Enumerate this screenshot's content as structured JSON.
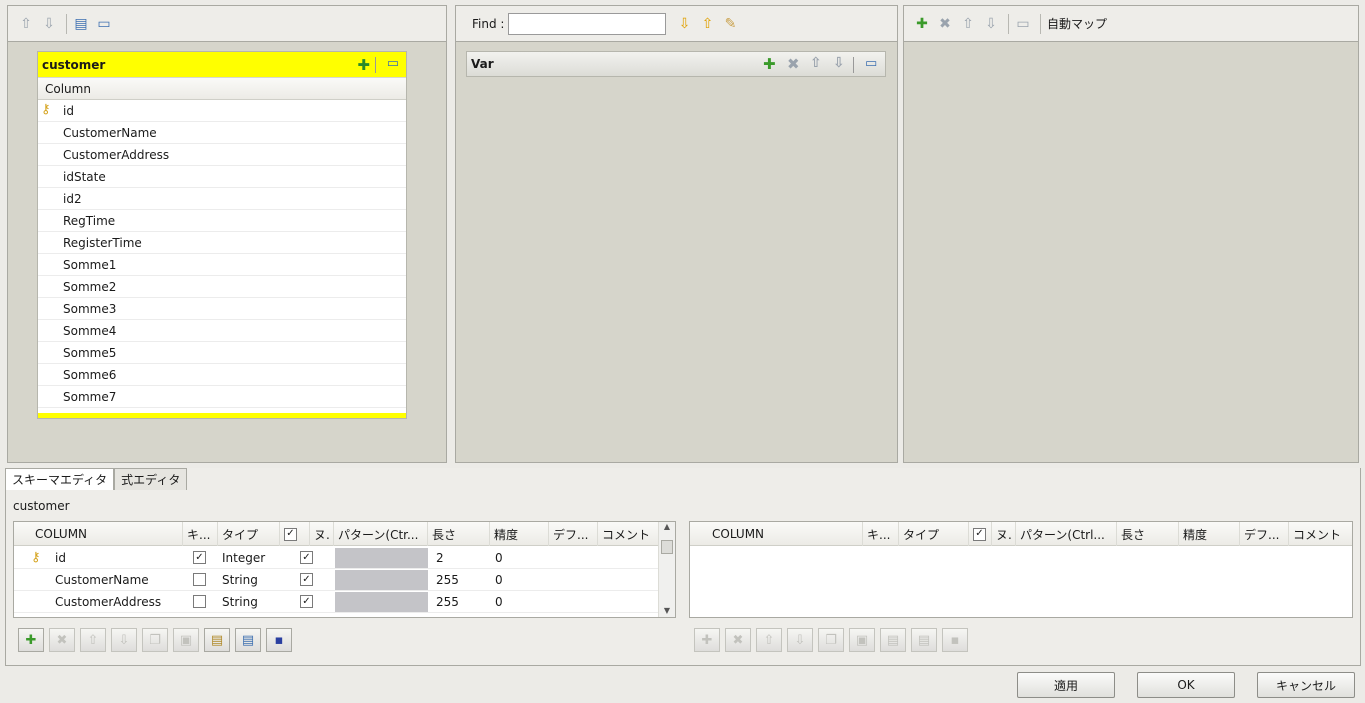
{
  "left_panel": {
    "table": {
      "name": "customer",
      "column_header": "Column",
      "rows": [
        "id",
        "CustomerName",
        "CustomerAddress",
        "idState",
        "id2",
        "RegTime",
        "RegisterTime",
        "Somme1",
        "Somme2",
        "Somme3",
        "Somme4",
        "Somme5",
        "Somme6",
        "Somme7"
      ]
    }
  },
  "middle_panel": {
    "find_label": "Find :",
    "find_value": "",
    "var_title": "Var"
  },
  "right_panel": {
    "auto_map_label": "自動マップ"
  },
  "bottom": {
    "tabs": [
      "スキーマエディタ",
      "式エディタ"
    ],
    "schema_title": "customer",
    "left_grid": {
      "headers": [
        "COLUMN",
        "キ...",
        "タイプ",
        "✓",
        "ヌ.",
        "パターン(Ctr...",
        "長さ",
        "精度",
        "デフ...",
        "コメント"
      ],
      "rows": [
        {
          "name": "id",
          "key": true,
          "type": "Integer",
          "nullable": true,
          "length": "2",
          "precision": "0"
        },
        {
          "name": "CustomerName",
          "key": false,
          "type": "String",
          "nullable": true,
          "length": "255",
          "precision": "0"
        },
        {
          "name": "CustomerAddress",
          "key": false,
          "type": "String",
          "nullable": true,
          "length": "255",
          "precision": "0"
        }
      ]
    },
    "right_grid": {
      "headers": [
        "COLUMN",
        "キ...",
        "タイプ",
        "✓",
        "ヌ.",
        "パターン(Ctrl...",
        "長さ",
        "精度",
        "デフ...",
        "コメント"
      ]
    }
  },
  "buttons": {
    "apply": "適用",
    "ok": "OK",
    "cancel": "キャンセル"
  },
  "colors": {
    "table_title_bg": "#ffff00",
    "panel_bg": "#d6d5cb",
    "add_icon": "#3a9a2a"
  }
}
